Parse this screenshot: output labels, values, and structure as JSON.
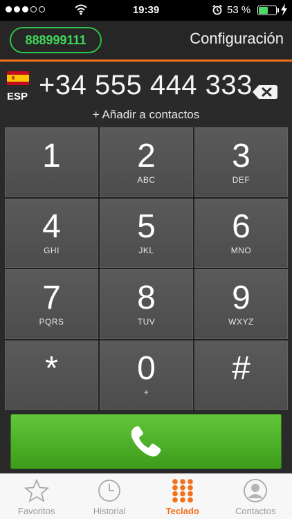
{
  "status_bar": {
    "time": "19:39",
    "battery_percent": "53 %",
    "battery_level": 0.53,
    "signal_bars": 3,
    "signal_total": 5
  },
  "header": {
    "account_number": "888999111",
    "config_label": "Configuración"
  },
  "dial": {
    "country_code": "ESP",
    "dialed_number": "+34 555 444 333",
    "add_contact": "+ Añadir a contactos"
  },
  "keypad": [
    {
      "digit": "1",
      "letters": ""
    },
    {
      "digit": "2",
      "letters": "ABC"
    },
    {
      "digit": "3",
      "letters": "DEF"
    },
    {
      "digit": "4",
      "letters": "GHI"
    },
    {
      "digit": "5",
      "letters": "JKL"
    },
    {
      "digit": "6",
      "letters": "MNO"
    },
    {
      "digit": "7",
      "letters": "PQRS"
    },
    {
      "digit": "8",
      "letters": "TUV"
    },
    {
      "digit": "9",
      "letters": "WXYZ"
    },
    {
      "digit": "*",
      "letters": ""
    },
    {
      "digit": "0",
      "letters": "+"
    },
    {
      "digit": "#",
      "letters": ""
    }
  ],
  "tabs": [
    {
      "label": "Favoritos",
      "icon": "star-icon",
      "active": false
    },
    {
      "label": "Historial",
      "icon": "clock-icon",
      "active": false
    },
    {
      "label": "Teclado",
      "icon": "keypad-icon",
      "active": true
    },
    {
      "label": "Contactos",
      "icon": "contact-icon",
      "active": false
    }
  ],
  "colors": {
    "accent": "#f2711c",
    "call_green": "#4cae28",
    "pill_green": "#2ec24a"
  }
}
